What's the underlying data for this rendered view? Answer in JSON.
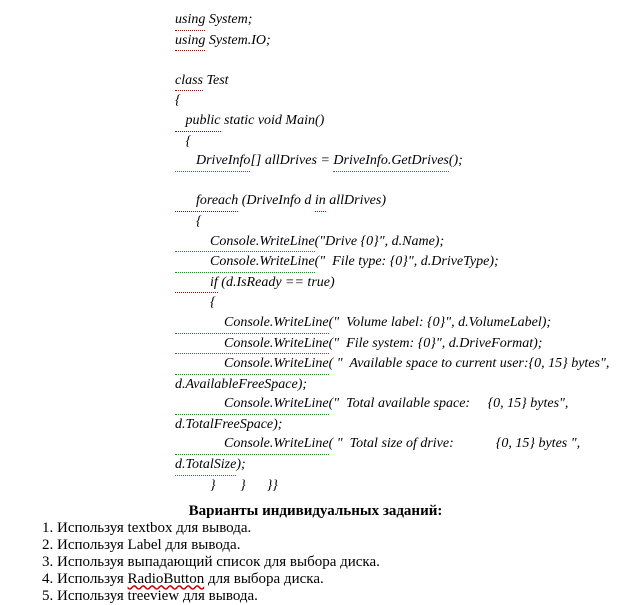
{
  "code": {
    "l1a": "using",
    "l1b": " System;",
    "l2a": "using",
    "l2b": " System.IO;",
    "l3a": "class",
    "l3b": " Test",
    "l4": "{",
    "l5a": "   public",
    "l5b": " static void Main()",
    "l6": "   {",
    "l7a": "      DriveInfo",
    "l7b": "[] allDrives = ",
    "l7c": "DriveInfo.GetDrives",
    "l7d": "();",
    "l8a": "      foreach",
    "l8b": " (DriveInfo d ",
    "l8c": "in",
    "l8d": " allDrives)",
    "l9": "      {",
    "l10a": "          Console.WriteLine",
    "l10b": "(\"Drive {0}\", d.Name);",
    "l11a": "          Console.WriteLine",
    "l11b": "(\"  File type: {0}\", d.DriveType);",
    "l12a": "          if",
    "l12b": " (d.IsReady == true)",
    "l13": "          {",
    "l14a": "              Console.WriteLine",
    "l14b": "(\"  Volume label: {0}\", d.VolumeLabel);",
    "l15a": "              Console.WriteLine",
    "l15b": "(\"  File system: {0}\", d.DriveFormat);",
    "l16a": "              Console.WriteLine",
    "l16b": "( \"  Available space to current user:{0, 15} bytes\",",
    "l17": "d.AvailableFreeSpace);",
    "l18a": "              Console.WriteLine",
    "l18b": "(\"  Total available space:     {0, 15} bytes\",",
    "l19": "d.TotalFreeSpace);",
    "l20a": "              Console.WriteLine",
    "l20b": "( \"  Total size of drive:            {0, 15} bytes \",",
    "l21a": "d.TotalSize",
    "l21b": ");",
    "l22": "          }       }      }}"
  },
  "heading": "Варианты индивидуальных заданий:",
  "list": {
    "i1": "1. Используя textbox для вывода.",
    "i2": "2. Используя Label для вывода.",
    "i3": "3. Используя выпадающий список для выбора диска.",
    "i4a": "4. Используя ",
    "i4b": "RadioButton",
    "i4c": " для выбора диска.",
    "i5": "5. Используя treeview для вывода."
  }
}
